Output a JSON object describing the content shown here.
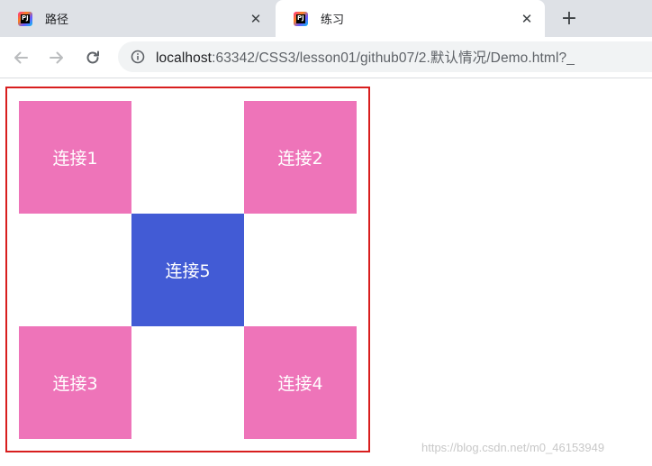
{
  "browser": {
    "tabs": [
      {
        "title": "路径",
        "close": "✕",
        "active": false
      },
      {
        "title": "练习",
        "close": "✕",
        "active": true
      }
    ],
    "new_tab": "+",
    "favicon_letter": "PJ",
    "url": {
      "host": "localhost",
      "rest": ":63342/CSS3/lesson01/github07/2.默认情况/Demo.html?_"
    }
  },
  "page": {
    "links": [
      {
        "label": "连接1",
        "color": "#ee74b9"
      },
      {
        "label": "连接2",
        "color": "#ee74b9"
      },
      {
        "label": "连接5",
        "color": "#425bd5"
      },
      {
        "label": "连接3",
        "color": "#ee74b9"
      },
      {
        "label": "连接4",
        "color": "#ee74b9"
      }
    ],
    "border_color": "#d81e1e"
  },
  "watermark": "https://blog.csdn.net/m0_46153949"
}
